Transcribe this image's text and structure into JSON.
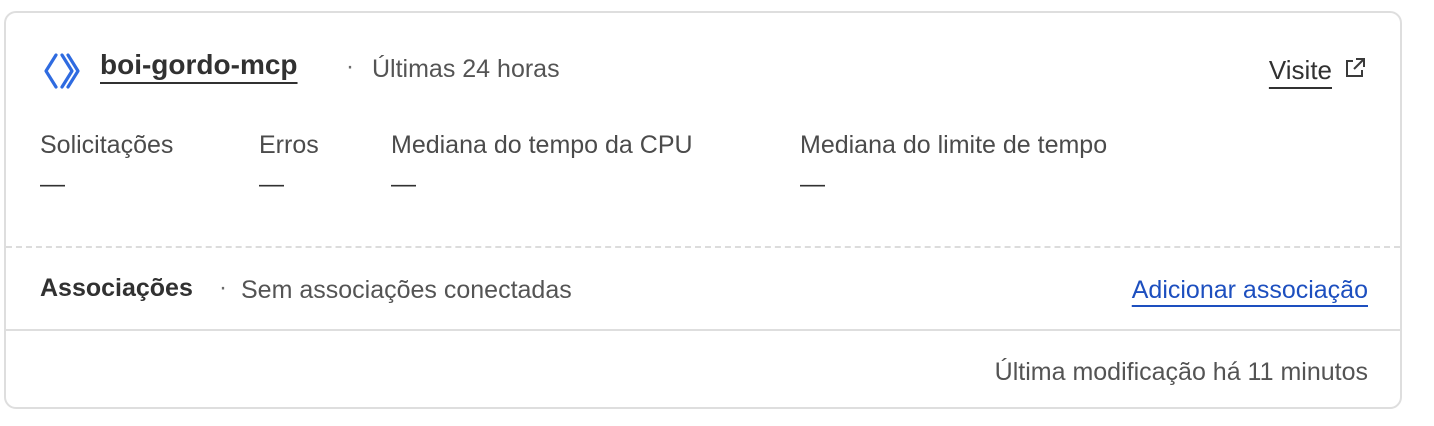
{
  "worker": {
    "name": "boi-gordo-mcp",
    "separator": "·",
    "timeframe": "Últimas 24 horas",
    "icon": "worker-chevrons-icon",
    "visit_label": "Visite",
    "visit_icon": "external-link-icon"
  },
  "metrics": [
    {
      "label": "Solicitações",
      "value": "—"
    },
    {
      "label": "Erros",
      "value": "—"
    },
    {
      "label": "Mediana do tempo da CPU",
      "value": "—"
    },
    {
      "label": "Mediana do limite de tempo",
      "value": "—"
    }
  ],
  "bindings": {
    "title": "Associações",
    "separator": "·",
    "status": "Sem associações conectadas",
    "add_label": "Adicionar associação"
  },
  "footer": {
    "last_modified": "Última modificação há 11 minutos"
  },
  "colors": {
    "accent_link": "#1d4fbf",
    "icon_blue": "#2f6be0",
    "border": "#dedede",
    "text_primary": "#313131",
    "text_secondary": "#545454"
  }
}
